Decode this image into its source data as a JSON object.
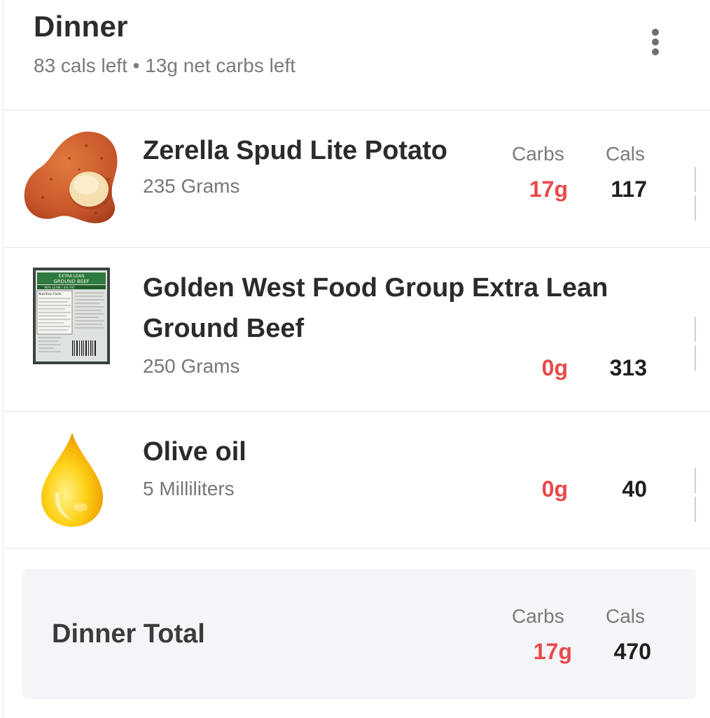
{
  "meal": {
    "title": "Dinner",
    "subtitle": "83 cals left • 13g net carbs left"
  },
  "columns": {
    "carbs": "Carbs",
    "cals": "Cals"
  },
  "items": [
    {
      "name": "Zerella Spud Lite Potato",
      "quantity": "235 Grams",
      "carbs": "17g",
      "cals": "117",
      "icon": "potato-icon"
    },
    {
      "name_line1": "Golden West Food Group Extra Lean",
      "name_line2": "Ground Beef",
      "quantity": "250 Grams",
      "carbs": "0g",
      "cals": "313",
      "icon": "ground-beef-package-icon",
      "label_text": [
        "EXTRA LEAN",
        "GROUND BEEF",
        "96% LEAN / 4% FAT",
        "Nutrition Facts"
      ]
    },
    {
      "name": "Olive oil",
      "quantity": "5 Milliliters",
      "carbs": "0g",
      "cals": "40",
      "icon": "oil-drop-icon"
    }
  ],
  "total": {
    "label": "Dinner Total",
    "carbs": "17g",
    "cals": "470"
  },
  "colors": {
    "carbs": "#e8494b",
    "cals": "#1f1f1f",
    "muted": "#7a7a7a",
    "total_bg": "#f4f5f8"
  }
}
